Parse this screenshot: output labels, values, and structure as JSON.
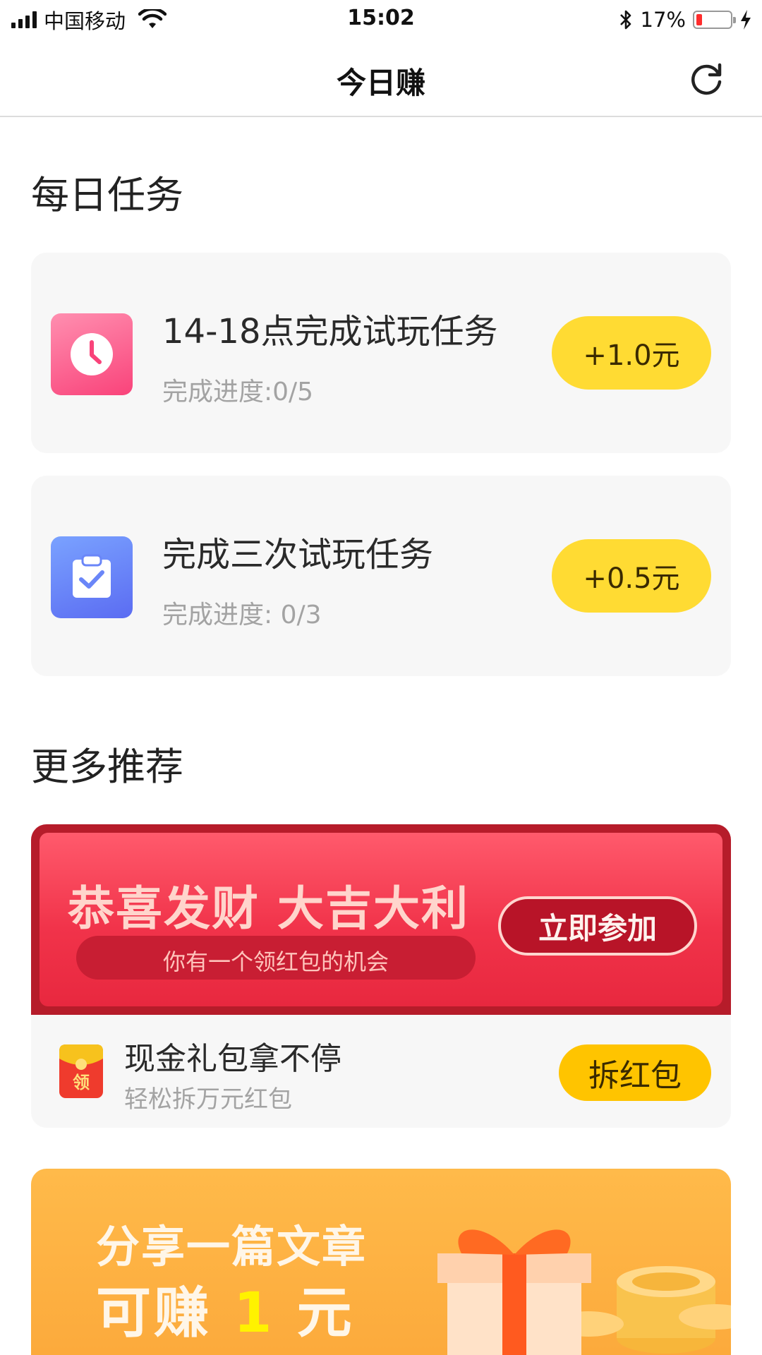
{
  "status_bar": {
    "carrier": "中国移动",
    "time": "15:02",
    "battery_percent": "17%",
    "battery_level": 0.17
  },
  "nav": {
    "title": "今日赚",
    "refresh_icon": "refresh-icon"
  },
  "daily_tasks": {
    "heading": "每日任务",
    "items": [
      {
        "icon": "clock-icon",
        "title": "14-18点完成试玩任务",
        "progress": "完成进度:0/5",
        "reward": "+1.0元"
      },
      {
        "icon": "clipboard-check-icon",
        "title": "完成三次试玩任务",
        "progress": "完成进度: 0/3",
        "reward": "+0.5元"
      }
    ]
  },
  "more": {
    "heading": "更多推荐",
    "red_packet": {
      "headline": "恭喜发财  大吉大利",
      "subline": "你有一个领红包的机会",
      "join_label": "立即参加",
      "icon": "red-envelope-icon",
      "icon_glyph": "领",
      "title": "现金礼包拿不停",
      "subtitle": "轻松拆万元红包",
      "open_label": "拆红包"
    },
    "share": {
      "line1": "分享一篇文章",
      "line2_prefix": "可赚 ",
      "line2_amount": "1",
      "line2_suffix": " 元"
    }
  },
  "colors": {
    "reward_yellow": "#ffdb33",
    "open_button": "#ffc400",
    "banner_red": "#f1334a",
    "share_orange": "#fcaa3c"
  }
}
